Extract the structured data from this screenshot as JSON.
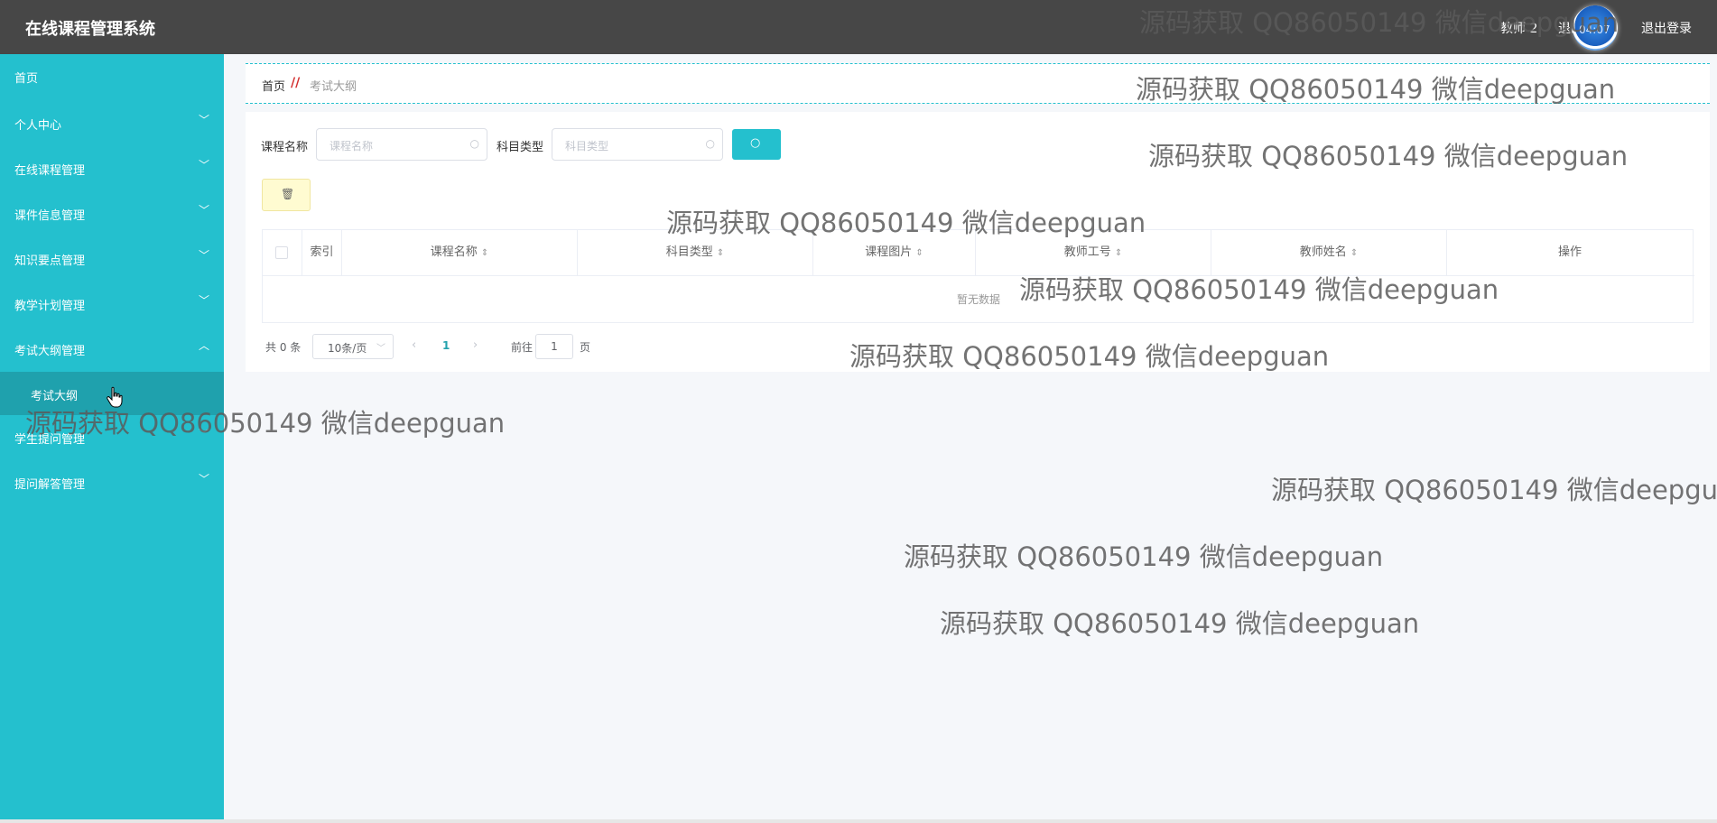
{
  "app": {
    "title": "在线课程管理系统"
  },
  "header": {
    "user_role": "教师 2",
    "exit_system": "退出",
    "clock_time": "04:07",
    "logout": "退出登录"
  },
  "sidebar": {
    "items": [
      {
        "label": "首页"
      },
      {
        "label": "个人中心",
        "chevron": "﹀"
      },
      {
        "label": "在线课程管理",
        "chevron": "﹀"
      },
      {
        "label": "课件信息管理",
        "chevron": "﹀"
      },
      {
        "label": "知识要点管理",
        "chevron": "﹀"
      },
      {
        "label": "教学计划管理",
        "chevron": "﹀"
      },
      {
        "label": "考试大纲管理",
        "chevron": "︿"
      },
      {
        "label": "学生提问管理",
        "chevron": "﹀"
      },
      {
        "label": "提问解答管理",
        "chevron": "﹀"
      }
    ],
    "active_sub_item": "考试大纲"
  },
  "breadcrumb": {
    "home": "首页",
    "separator": "//",
    "current": "考试大纲"
  },
  "search": {
    "course_name_label": "课程名称",
    "course_name_placeholder": "课程名称",
    "subject_type_label": "科目类型",
    "subject_type_placeholder": "科目类型",
    "search_icon": "search-icon"
  },
  "actions": {
    "delete_icon": "trash-icon"
  },
  "table": {
    "columns": [
      "索引",
      "课程名称",
      "科目类型",
      "课程图片",
      "教师工号",
      "教师姓名",
      "操作"
    ],
    "empty_text": "暂无数据"
  },
  "pagination": {
    "total": "共 0 条",
    "page_size": "10条/页",
    "current_page": "1",
    "goto_label": "前往",
    "goto_value": "1",
    "page_unit": "页"
  },
  "watermark": {
    "text": "源码获取 QQ86050149 微信deepguan",
    "text_cut": "源码获取 QQ86050149 微信deepgu"
  },
  "colors": {
    "accent": "#24c0ce",
    "header_bg": "#474747",
    "active_submenu": "#1fa1ad"
  }
}
